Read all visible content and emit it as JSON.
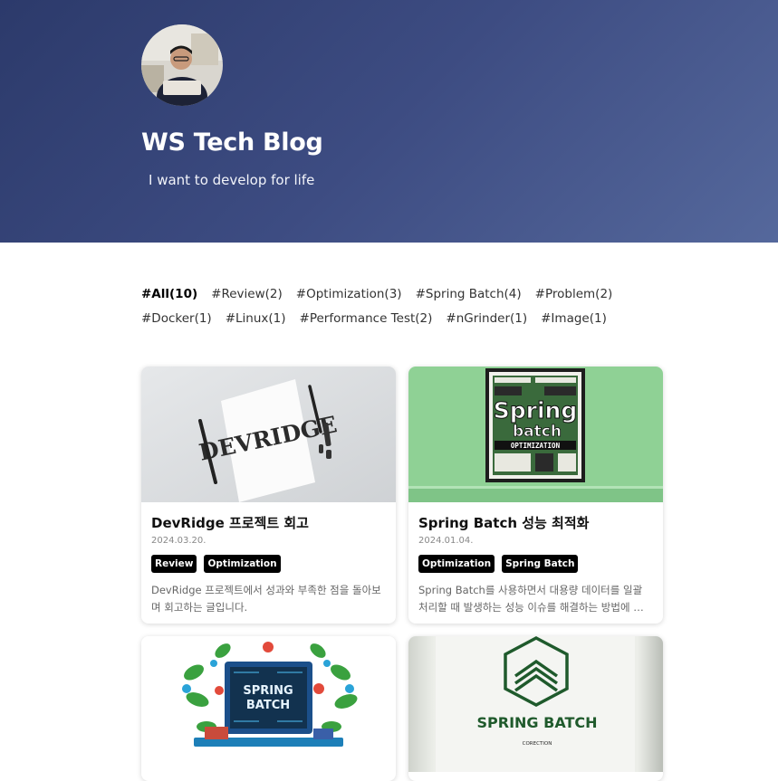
{
  "header": {
    "title": "WS Tech Blog",
    "description": "I want to develop for life"
  },
  "tags": [
    {
      "label": "#All(10)",
      "active": true
    },
    {
      "label": "#Review(2)"
    },
    {
      "label": "#Optimization(3)"
    },
    {
      "label": "#Spring Batch(4)"
    },
    {
      "label": "#Problem(2)"
    },
    {
      "label": "#Docker(1)"
    },
    {
      "label": "#Linux(1)"
    },
    {
      "label": "#Performance Test(2)"
    },
    {
      "label": "#nGrinder(1)"
    },
    {
      "label": "#Image(1)"
    }
  ],
  "posts": [
    {
      "title": "DevRidge 프로젝트 회고",
      "date": "2024.03.20.",
      "categories": [
        "Review",
        "Optimization"
      ],
      "summary": "DevRidge 프로젝트에서 성과와 부족한 점을 돌아보며 회고하는 글입니다.",
      "thumb_text": "DEVRIDGE"
    },
    {
      "title": "Spring Batch 성능 최적화",
      "date": "2024.01.04.",
      "categories": [
        "Optimization",
        "Spring Batch"
      ],
      "summary": "Spring Batch를 사용하면서 대용량 데이터를 일괄 처리할 때 발생하는 성능 이슈를 해결하는 방법에 대해 정리합니다.",
      "thumb_text": [
        "Spring",
        "batch",
        "OPTIMIZATION"
      ]
    },
    {
      "thumb_text": [
        "SPRING",
        "BATCH"
      ]
    },
    {
      "thumb_text": [
        "SPRING BATCH",
        "CORECTION"
      ]
    }
  ]
}
